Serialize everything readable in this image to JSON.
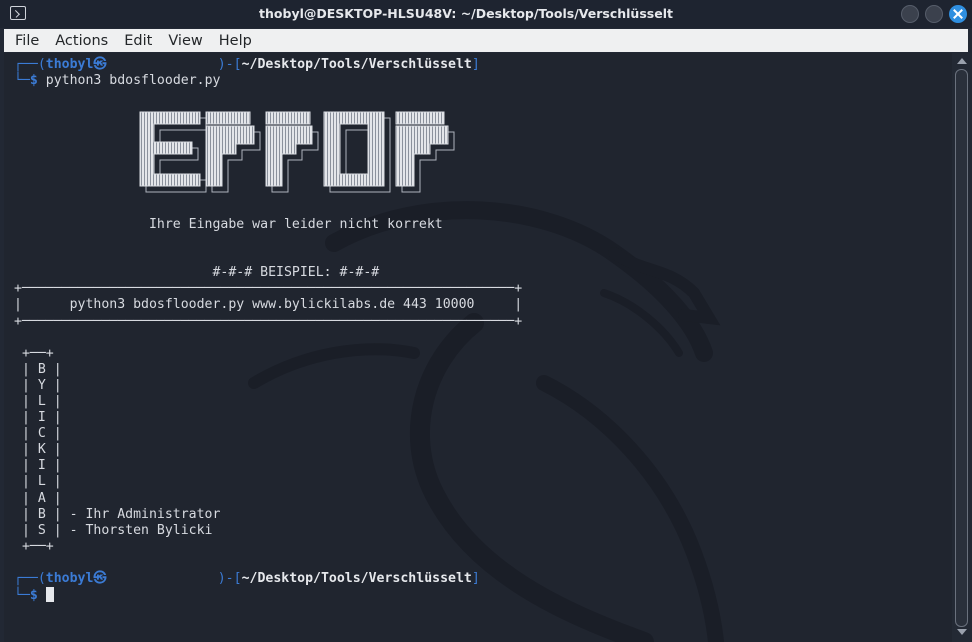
{
  "window": {
    "title": "thobyl@DESKTOP-HLSU48V: ~/Desktop/Tools/Verschlüsselt"
  },
  "menu": [
    "File",
    "Actions",
    "Edit",
    "View",
    "Help"
  ],
  "prompt1": {
    "box_open": "┌──(",
    "user": "thobyl㉿",
    "box_mid": "              )-[",
    "path": "~/Desktop/Tools/Verschlüsselt",
    "box_close": "]",
    "corner": "└─",
    "dollar": "$",
    "command": " python3 bdosflooder.py"
  },
  "banner_text": "ERROR",
  "output": {
    "message": "                 Ihre Eingabe war leider nicht korrekt",
    "example_header": "                         #-#-# BEISPIEL: #-#-#",
    "box_top": "+──────────────────────────────────────────────────────────────+",
    "example_line": "|      python3 bdosflooder.py www.bylickilabs.de 443 10000     |",
    "box_bottom": "+──────────────────────────────────────────────────────────────+",
    "vertical": [
      " +──+",
      " | B |",
      " | Y |",
      " | L |",
      " | I |",
      " | C |",
      " | K |",
      " | I |",
      " | L |",
      " | A |",
      " | B | - Ihr Administrator",
      " | S | - Thorsten Bylicki",
      " +──+"
    ]
  },
  "prompt2": {
    "box_open": "┌──(",
    "user": "thobyl㉿",
    "box_mid": "              )-[",
    "path": "~/Desktop/Tools/Verschlüsselt",
    "box_close": "]",
    "corner": "└─",
    "dollar": "$"
  },
  "colors": {
    "accent": "#3b7bd5",
    "terminal_bg": "#20252f",
    "text": "#d7dae0"
  }
}
